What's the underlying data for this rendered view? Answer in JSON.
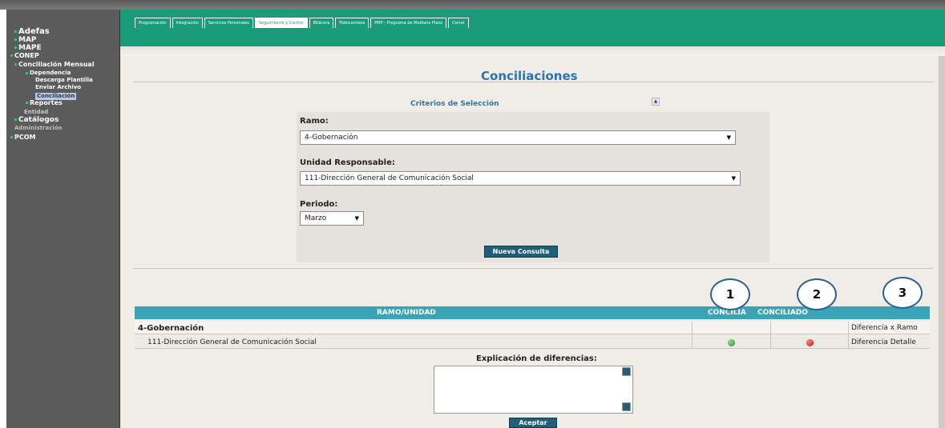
{
  "sidebar": {
    "adefas": "Adefas",
    "map": "MAP",
    "mape": "MAPE",
    "conep": "CONEP",
    "conciliacion_mensual": "Conciliación Mensual",
    "dependencia": "Dependencia",
    "descarga_plantilla": "Descarga Plantilla",
    "enviar_archivo": "Enviar Archivo",
    "conciliacion": "Conciliación",
    "reportes": "Reportes",
    "entidad": "Entidad",
    "catalogos": "Catálogos",
    "administracion": "Administración",
    "pcom": "PCOM"
  },
  "nav": {
    "tabs": [
      "Programación",
      "Integración",
      "Servicios Personales",
      "Seguimiento y Control",
      "Bitácora",
      "Fideicomisos",
      "PMP - Programa de Mediano Plazo",
      "Cerrar"
    ],
    "active_tab": "Seguimiento y Control"
  },
  "page": {
    "title": "Conciliaciones"
  },
  "criteria": {
    "title": "Criterios de Selección",
    "collapse_icon": "caret-up-icon",
    "ramo_label": "Ramo:",
    "ramo_value": "4-Gobernación",
    "ur_label": "Unidad Responsable:",
    "ur_value": "111-Dirección General de Comunicación Social",
    "periodo_label": "Periodo:",
    "periodo_value": "Marzo",
    "nueva_consulta": "Nueva Consulta"
  },
  "results": {
    "headers": {
      "ramo_unidad": "RAMO/UNIDAD",
      "concilia": "CONCILIA",
      "conciliado": "CONCILIADO"
    },
    "rows": [
      {
        "label": "4-Gobernación",
        "link": "Diferencia x Ramo"
      },
      {
        "label": "111-Dirección General de Comunicación Social",
        "link": "Diferencia Detalle",
        "concilia_status": "green",
        "conciliado_status": "red"
      }
    ]
  },
  "annotations": [
    "1",
    "2",
    "3"
  ],
  "explanation": {
    "label": "Explicación de diferencias:",
    "value": "",
    "aceptar": "Aceptar"
  },
  "colors": {
    "nav_green": "#1a9c7a",
    "title_blue": "#2a74b8",
    "header_teal": "#3aa3b8",
    "button_blue": "#1f5f79"
  }
}
